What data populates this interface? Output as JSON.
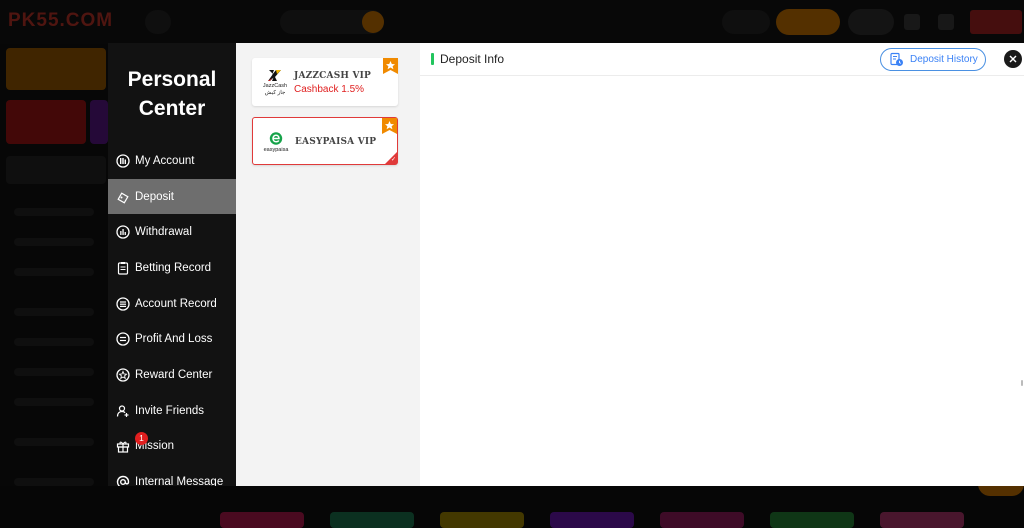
{
  "background": {
    "logo_text": "PK55.COM"
  },
  "personal_center": {
    "title_line1": "Personal",
    "title_line2": "Center"
  },
  "menu": {
    "items": [
      {
        "label": "My Account",
        "icon": "account-icon",
        "active": false
      },
      {
        "label": "Deposit",
        "icon": "deposit-icon",
        "active": true
      },
      {
        "label": "Withdrawal",
        "icon": "withdrawal-icon",
        "active": false
      },
      {
        "label": "Betting Record",
        "icon": "clipboard-icon",
        "active": false
      },
      {
        "label": "Account Record",
        "icon": "list-icon",
        "active": false
      },
      {
        "label": "Profit And Loss",
        "icon": "chart-icon",
        "active": false
      },
      {
        "label": "Reward Center",
        "icon": "reward-icon",
        "active": false
      },
      {
        "label": "Invite Friends",
        "icon": "invite-icon",
        "active": false
      },
      {
        "label": "Mission",
        "icon": "gift-icon",
        "active": false,
        "badge": "1"
      },
      {
        "label": "Internal Message",
        "icon": "at-icon",
        "active": false
      }
    ]
  },
  "payment_methods": [
    {
      "name": "JAZZCASH VIP",
      "cashback": "Cashback 1.5%",
      "logo_caption": "JazzCash",
      "logo_caption_2": "جاز کیش",
      "selected": false
    },
    {
      "name": "EASYPAISA VIP",
      "cashback": "",
      "logo_caption": "easypaisa",
      "selected": true
    }
  ],
  "deposit_info": {
    "title": "Deposit Info",
    "history_label": "Deposit History"
  },
  "colors": {
    "accent_green": "#22c55e",
    "cashback_red": "#e02020",
    "selected_border": "#e03a3a",
    "history_blue": "#3b82f6",
    "menu_active": "#6e6e6e"
  }
}
